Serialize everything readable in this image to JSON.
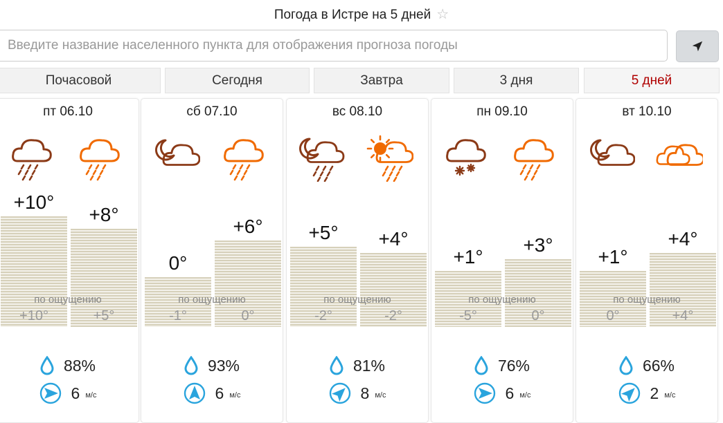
{
  "page": {
    "title": "Погода в Истре на 5 дней",
    "star_icon": "star-icon"
  },
  "search": {
    "placeholder": "Введите название населенного пункта для отображения прогноза погоды",
    "locate_icon": "location-arrow-icon"
  },
  "tabs": [
    {
      "label": "Почасовой",
      "active": false
    },
    {
      "label": "Сегодня",
      "active": false
    },
    {
      "label": "Завтра",
      "active": false
    },
    {
      "label": "3 дня",
      "active": false
    },
    {
      "label": "5 дней",
      "active": true
    }
  ],
  "colors": {
    "night_icon": "#8b3a17",
    "day_icon": "#f06a00",
    "drop": "#2aa4dd",
    "wind": "#2aa4dd",
    "active_tab": "#b00000"
  },
  "feels_like_label": "по ощущению",
  "wind_unit": "м/с",
  "days": [
    {
      "date": "пт 06.10",
      "night_icon": "cloud-rain-icon",
      "day_icon": "cloud-rain-icon",
      "night_temp": "+10°",
      "day_temp": "+8°",
      "night_feel": "+10°",
      "day_feel": "+5°",
      "humidity": "88%",
      "wind_speed": "6",
      "wind_dir": "east"
    },
    {
      "date": "сб 07.10",
      "night_icon": "moon-cloud-icon",
      "day_icon": "cloud-rain-icon",
      "night_temp": "0°",
      "day_temp": "+6°",
      "night_feel": "-1°",
      "day_feel": "0°",
      "humidity": "93%",
      "wind_speed": "6",
      "wind_dir": "north"
    },
    {
      "date": "вс 08.10",
      "night_icon": "moon-cloud-rain-icon",
      "day_icon": "sun-cloud-rain-icon",
      "night_temp": "+5°",
      "day_temp": "+4°",
      "night_feel": "-2°",
      "day_feel": "-2°",
      "humidity": "81%",
      "wind_speed": "8",
      "wind_dir": "north-east"
    },
    {
      "date": "пн 09.10",
      "night_icon": "cloud-snow-icon",
      "day_icon": "cloud-rain-icon",
      "night_temp": "+1°",
      "day_temp": "+3°",
      "night_feel": "-5°",
      "day_feel": "0°",
      "humidity": "76%",
      "wind_speed": "6",
      "wind_dir": "east"
    },
    {
      "date": "вт 10.10",
      "night_icon": "moon-cloud-icon",
      "day_icon": "clouds-icon",
      "night_temp": "+1°",
      "day_temp": "+4°",
      "night_feel": "0°",
      "day_feel": "+4°",
      "humidity": "66%",
      "wind_speed": "2",
      "wind_dir": "north-east"
    }
  ]
}
